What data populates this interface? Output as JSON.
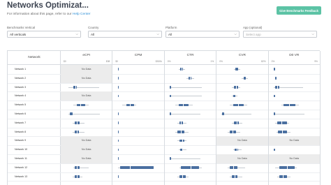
{
  "header": {
    "title": "Networks Optimizat...",
    "info_text": "For information about this page, refer to our ",
    "info_link": "Help Center",
    "feedback_button": "Give Benchmarks Feedback"
  },
  "filters": [
    {
      "label": "Benchmarks Vertical",
      "value": "All verticals",
      "placeholder": ""
    },
    {
      "label": "Country",
      "value": "All",
      "placeholder": ""
    },
    {
      "label": "Platform",
      "value": "All",
      "placeholder": ""
    },
    {
      "label": "App (optional)",
      "value": "",
      "placeholder": "Select app"
    }
  ],
  "table": {
    "network_header": "Network",
    "metrics": [
      {
        "name": "eCPI",
        "min": "$0",
        "max": "$38"
      },
      {
        "name": "CPM",
        "min": "$0",
        "max": "$300k"
      },
      {
        "name": "CTR",
        "min": "0%",
        "max": "1%"
      },
      {
        "name": "CVR",
        "min": "0%",
        "max": "82%"
      },
      {
        "name": "D0 VR",
        "min": "0%",
        "max": "9%"
      }
    ],
    "no_data_label": "No Data",
    "rows": [
      {
        "network": "Network 1",
        "cells": [
          {
            "nodata": true
          },
          {
            "whisker": [
              0.03,
              0.05
            ],
            "iqr": [
              0.03,
              0.05
            ],
            "median": 0.04
          },
          {
            "whisker": [
              0.22,
              0.38
            ],
            "iqr": [
              0.26,
              0.33
            ],
            "median": 0.29
          },
          {
            "whisker": [
              0.3,
              0.45
            ],
            "iqr": [
              0.34,
              0.4
            ],
            "median": 0.37
          },
          {
            "whisker": [
              0.03,
              0.06
            ],
            "iqr": [
              0.03,
              0.05
            ],
            "median": 0.04
          }
        ]
      },
      {
        "network": "Network 2",
        "cells": [
          {
            "nodata": true
          },
          {
            "whisker": [
              0.03,
              0.05
            ],
            "iqr": [
              0.03,
              0.05
            ],
            "median": 0.04
          },
          {
            "whisker": [
              0.4,
              0.58
            ],
            "iqr": [
              0.45,
              0.52
            ],
            "median": 0.48
          },
          {
            "whisker": [
              0.48,
              0.62
            ],
            "iqr": [
              0.52,
              0.58
            ],
            "median": 0.55
          },
          {
            "whisker": [
              0.05,
              0.09
            ],
            "iqr": [
              0.05,
              0.08
            ],
            "median": 0.06
          }
        ]
      },
      {
        "network": "Network 3",
        "cells": [
          {
            "whisker": [
              0.08,
              0.78
            ],
            "iqr": [
              0.2,
              0.28
            ],
            "median": 0.24
          },
          {
            "whisker": [
              0.03,
              0.05
            ],
            "iqr": [
              0.03,
              0.05
            ],
            "median": 0.04
          },
          {
            "whisker": [
              0.02,
              0.75
            ],
            "iqr": [
              0.02,
              0.05
            ],
            "median": 0.03
          },
          {
            "whisker": [
              0.25,
              0.45
            ],
            "iqr": [
              0.3,
              0.4
            ],
            "median": 0.35
          },
          {
            "whisker": [
              0.02,
              0.7
            ],
            "iqr": [
              0.06,
              0.15
            ],
            "median": 0.1
          }
        ]
      },
      {
        "network": "Network 4",
        "cells": [
          {
            "nodata": true
          },
          {
            "whisker": [
              0.03,
              0.05
            ],
            "iqr": [
              0.03,
              0.05
            ],
            "median": 0.04
          },
          {
            "whisker": [
              0.02,
              0.75
            ],
            "iqr": [
              0.02,
              0.05
            ],
            "median": 0.03
          },
          {
            "whisker": [
              0.25,
              0.38
            ],
            "iqr": [
              0.28,
              0.34
            ],
            "median": 0.31
          },
          {
            "whisker": [
              0.03,
              0.06
            ],
            "iqr": [
              0.03,
              0.05
            ],
            "median": 0.04
          }
        ]
      },
      {
        "network": "Network 5",
        "cells": [
          {
            "whisker": [
              0.2,
              0.55
            ],
            "iqr": [
              0.28,
              0.47
            ],
            "median": 0.36
          },
          {
            "whisker": [
              0.12,
              0.45
            ],
            "iqr": [
              0.22,
              0.4
            ],
            "median": 0.3
          },
          {
            "whisker": [
              0.15,
              0.55
            ],
            "iqr": [
              0.22,
              0.45
            ],
            "median": 0.32
          },
          {
            "whisker": [
              0.2,
              0.6
            ],
            "iqr": [
              0.28,
              0.52
            ],
            "median": 0.4
          },
          {
            "whisker": [
              0.2,
              0.6
            ],
            "iqr": [
              0.25,
              0.52
            ],
            "median": 0.38
          }
        ]
      },
      {
        "network": "Network 6",
        "cells": [
          {
            "whisker": [
              0.08,
              0.8
            ],
            "iqr": [
              0.12,
              0.18
            ],
            "median": 0.15
          },
          {
            "whisker": [
              0.03,
              0.05
            ],
            "iqr": [
              0.03,
              0.05
            ],
            "median": 0.04
          },
          {
            "whisker": [
              0.02,
              0.72
            ],
            "iqr": [
              0.02,
              0.05
            ],
            "median": 0.03
          },
          {
            "whisker": [
              0.02,
              0.7
            ],
            "iqr": [
              0.03,
              0.08
            ],
            "median": 0.05
          },
          {
            "whisker": [
              0.03,
              0.72
            ],
            "iqr": [
              0.03,
              0.06
            ],
            "median": 0.04
          }
        ]
      },
      {
        "network": "Network 7",
        "cells": [
          {
            "whisker": [
              0.18,
              0.45
            ],
            "iqr": [
              0.22,
              0.34
            ],
            "median": 0.28
          },
          {
            "whisker": [
              0.03,
              0.05
            ],
            "iqr": [
              0.03,
              0.05
            ],
            "median": 0.04
          },
          {
            "whisker": [
              0.2,
              0.4
            ],
            "iqr": [
              0.24,
              0.33
            ],
            "median": 0.28
          },
          {
            "whisker": [
              0.25,
              0.5
            ],
            "iqr": [
              0.3,
              0.42
            ],
            "median": 0.36
          },
          {
            "whisker": [
              0.05,
              0.38
            ],
            "iqr": [
              0.1,
              0.32
            ],
            "median": 0.2
          }
        ]
      },
      {
        "network": "Network 8",
        "cells": [
          {
            "whisker": [
              0.18,
              0.45
            ],
            "iqr": [
              0.22,
              0.32
            ],
            "median": 0.27
          },
          {
            "whisker": [
              0.03,
              0.05
            ],
            "iqr": [
              0.03,
              0.05
            ],
            "median": 0.04
          },
          {
            "whisker": [
              0.15,
              0.45
            ],
            "iqr": [
              0.2,
              0.35
            ],
            "median": 0.27
          },
          {
            "whisker": [
              0.15,
              0.45
            ],
            "iqr": [
              0.2,
              0.35
            ],
            "median": 0.27
          },
          {
            "whisker": [
              0.08,
              0.4
            ],
            "iqr": [
              0.12,
              0.33
            ],
            "median": 0.22
          }
        ]
      },
      {
        "network": "Network 9",
        "cells": [
          {
            "nodata": true
          },
          {
            "whisker": [
              0.03,
              0.05
            ],
            "iqr": [
              0.03,
              0.05
            ],
            "median": 0.04
          },
          {
            "whisker": [
              0.2,
              0.4
            ],
            "iqr": [
              0.25,
              0.36
            ],
            "median": 0.3
          },
          {
            "nodata": true
          },
          {
            "nodata": true
          }
        ]
      },
      {
        "network": "Network 10",
        "cells": [
          {
            "nodata": true
          },
          {
            "whisker": [
              0.03,
              0.05
            ],
            "iqr": [
              0.03,
              0.05
            ],
            "median": 0.04
          },
          {
            "whisker": [
              0.22,
              0.4
            ],
            "iqr": [
              0.26,
              0.33
            ],
            "median": 0.3
          },
          {
            "whisker": [
              0.28,
              0.48
            ],
            "iqr": [
              0.32,
              0.4
            ],
            "median": 0.36
          },
          {
            "whisker": [
              0.03,
              0.06
            ],
            "iqr": [
              0.03,
              0.05
            ],
            "median": 0.04
          }
        ]
      },
      {
        "network": "Network 11",
        "cells": [
          {
            "nodata": true
          },
          {
            "whisker": [
              0.03,
              0.05
            ],
            "iqr": [
              0.03,
              0.05
            ],
            "median": 0.04
          },
          {
            "whisker": [
              0.02,
              0.72
            ],
            "iqr": [
              0.02,
              0.05
            ],
            "median": 0.03
          },
          {
            "nodata": true
          },
          {
            "nodata": true
          }
        ]
      },
      {
        "network": "Network 12",
        "cells": [
          {
            "whisker": [
              0.2,
              0.55
            ],
            "iqr": [
              0.22,
              0.34
            ],
            "median": 0.28
          },
          {
            "whisker": [
              0.03,
              0.8
            ],
            "iqr": [
              0.08,
              0.85
            ],
            "median": 0.3
          },
          {
            "whisker": [
              0.25,
              0.75
            ],
            "iqr": [
              0.28,
              0.7
            ],
            "median": 0.5
          },
          {
            "whisker": [
              0.15,
              0.55
            ],
            "iqr": [
              0.2,
              0.38
            ],
            "median": 0.28
          },
          {
            "whisker": [
              0.05,
              0.55
            ],
            "iqr": [
              0.15,
              0.5
            ],
            "median": 0.32
          }
        ]
      },
      {
        "network": "Network 13",
        "cells": [
          {
            "whisker": [
              0.18,
              0.4
            ],
            "iqr": [
              0.22,
              0.33
            ],
            "median": 0.27
          },
          {
            "whisker": [
              0.03,
              0.05
            ],
            "iqr": [
              0.03,
              0.05
            ],
            "median": 0.04
          },
          {
            "whisker": [
              0.2,
              0.45
            ],
            "iqr": [
              0.25,
              0.38
            ],
            "median": 0.31
          },
          {
            "whisker": [
              0.2,
              0.5
            ],
            "iqr": [
              0.25,
              0.38
            ],
            "median": 0.31
          },
          {
            "whisker": [
              0.1,
              0.4
            ],
            "iqr": [
              0.15,
              0.32
            ],
            "median": 0.23
          }
        ]
      }
    ]
  },
  "colors": {
    "bar": "#4a6fa0",
    "nodata_bg": "#ececec",
    "button_bg": "#5cc3a5",
    "link": "#2e8fd6"
  }
}
